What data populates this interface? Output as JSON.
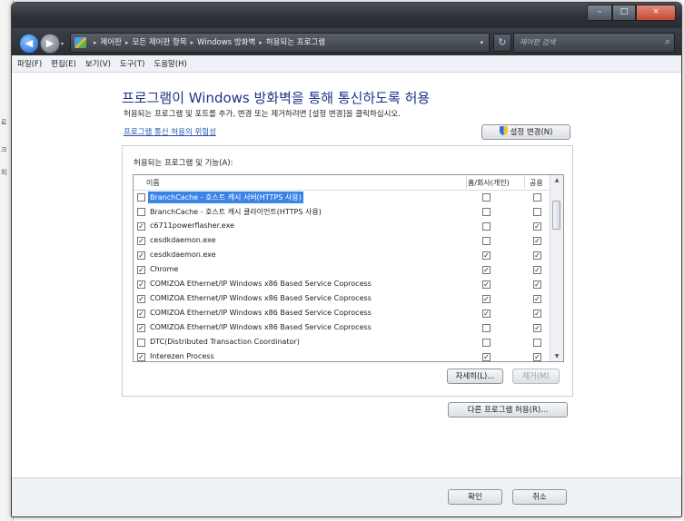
{
  "window": {
    "minimize": "–",
    "maximize": "□",
    "close": "×"
  },
  "nav": {
    "back": "◀",
    "forward": "▶"
  },
  "address": {
    "crumbs": [
      "제어판",
      "모든 제어판 항목",
      "Windows 방화벽",
      "허용되는 프로그램"
    ]
  },
  "search": {
    "placeholder": "제어판 검색"
  },
  "menu": [
    "파일(F)",
    "편집(E)",
    "보기(V)",
    "도구(T)",
    "도움말(H)"
  ],
  "main": {
    "heading": "프로그램이 Windows 방화벽을 통해 통신하도록 허용",
    "subtext": "허용되는 프로그램 및 포트를 추가, 변경 또는 제거하려면 [설정 변경]을 클릭하십시오.",
    "risk_link": "프로그램 통신 허용의 위험성",
    "settings_button": "설정 변경(N)",
    "group_label": "허용되는 프로그램 및 기능(A):",
    "columns": {
      "name": "이름",
      "home": "홈/회사(개인)",
      "public": "공용"
    },
    "rows": [
      {
        "name": "BranchCache - 호스트 캐시 서버(HTTPS 사용)",
        "enabled": false,
        "home": false,
        "public": false,
        "selected": true
      },
      {
        "name": "BranchCache - 호스트 캐시 클라이언트(HTTPS 사용)",
        "enabled": false,
        "home": false,
        "public": false,
        "selected": false
      },
      {
        "name": "c6711powerflasher.exe",
        "enabled": true,
        "home": false,
        "public": true,
        "selected": false
      },
      {
        "name": "cesdkdaemon.exe",
        "enabled": true,
        "home": false,
        "public": true,
        "selected": false
      },
      {
        "name": "cesdkdaemon.exe",
        "enabled": true,
        "home": true,
        "public": true,
        "selected": false
      },
      {
        "name": "Chrome",
        "enabled": true,
        "home": true,
        "public": true,
        "selected": false
      },
      {
        "name": "COMIZOA Ethernet/IP Windows x86 Based Service Coprocess",
        "enabled": true,
        "home": true,
        "public": true,
        "selected": false
      },
      {
        "name": "COMIZOA Ethernet/IP Windows x86 Based Service Coprocess",
        "enabled": true,
        "home": true,
        "public": true,
        "selected": false
      },
      {
        "name": "COMIZOA Ethernet/IP Windows x86 Based Service Coprocess",
        "enabled": true,
        "home": true,
        "public": true,
        "selected": false
      },
      {
        "name": "COMIZOA Ethernet/IP Windows x86 Based Service Coprocess",
        "enabled": true,
        "home": false,
        "public": true,
        "selected": false
      },
      {
        "name": "DTC(Distributed Transaction Coordinator)",
        "enabled": false,
        "home": false,
        "public": false,
        "selected": false
      },
      {
        "name": "Interezen Process",
        "enabled": true,
        "home": true,
        "public": true,
        "selected": false
      }
    ],
    "details_button": "자세히(L)...",
    "remove_button": "제거(M)",
    "allow_other_button": "다른 프로그램 허용(R)..."
  },
  "footer": {
    "ok": "확인",
    "cancel": "취소"
  },
  "icons": {
    "check": "✓",
    "scroll_up": "▲",
    "scroll_down": "▼",
    "refresh": "↻",
    "search": "⌕",
    "crumb_sep": "▸",
    "address_dropdown": "▾"
  }
}
